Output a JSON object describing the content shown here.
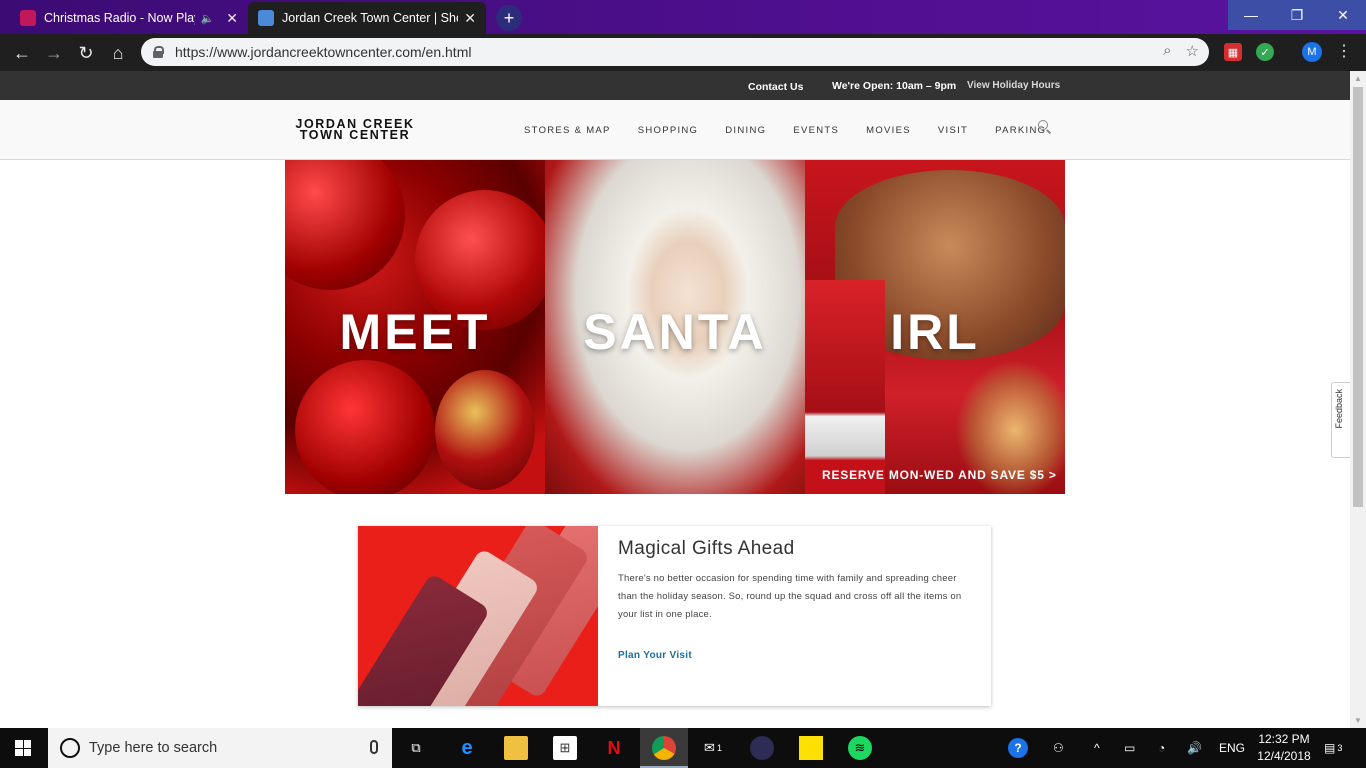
{
  "browser": {
    "tabs": [
      {
        "title": "Christmas Radio - Now Playing",
        "favicon_color": "#c2185b",
        "muted": true
      },
      {
        "title": "Jordan Creek Town Center | Shop",
        "favicon_color": "#4a8ad8",
        "active": true
      }
    ],
    "url": "https://www.jordancreektowncenter.com/en.html",
    "profile_initial": "M",
    "window_controls": {
      "minimize": "—",
      "restore": "❐",
      "close": "✕"
    }
  },
  "site": {
    "utility": {
      "contact": "Contact Us",
      "open": "We're Open: 10am – 9pm",
      "holiday_hours": "View Holiday Hours"
    },
    "logo": {
      "line1": "JORDAN CREEK",
      "line2": "TOWN CENTER"
    },
    "nav": [
      "STORES & MAP",
      "SHOPPING",
      "DINING",
      "EVENTS",
      "MOVIES",
      "VISIT",
      "PARKING"
    ],
    "hero": {
      "words": [
        "MEET",
        "SANTA",
        "IRL"
      ],
      "cta": "RESERVE MON-WED AND SAVE $5 >"
    },
    "feature": {
      "title": "Magical Gifts Ahead",
      "body": "There's no better occasion for spending time with family and spreading cheer than the holiday season. So, round up the squad and cross off all the items on your list in one place.",
      "link": "Plan Your Visit"
    },
    "feedback_tab": "Feedback"
  },
  "taskbar": {
    "search_placeholder": "Type here to search",
    "time": "12:32 PM",
    "date": "12/4/2018",
    "language": "ENG",
    "notifications": "3",
    "mail_badge": "1"
  }
}
